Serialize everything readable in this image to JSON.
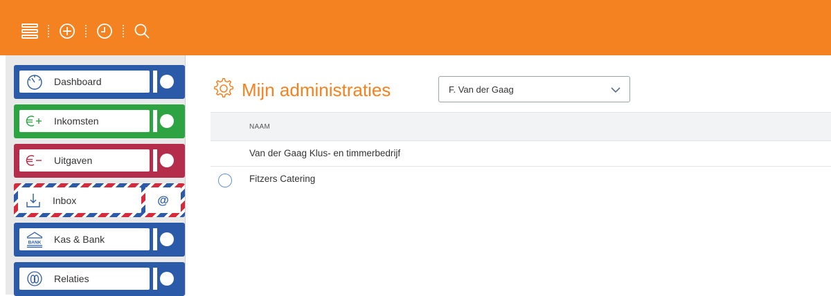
{
  "topbar": {
    "color": "#f58220",
    "icons": [
      "menu-icon",
      "add-icon",
      "clock-icon",
      "search-icon"
    ]
  },
  "sidebar": {
    "items": [
      {
        "label": "Dashboard",
        "icon": "dashboard-gauge-icon",
        "color": "#2b5ba8"
      },
      {
        "label": "Inkomsten",
        "icon": "euro-plus-icon",
        "color": "#2ea342"
      },
      {
        "label": "Uitgaven",
        "icon": "euro-minus-icon",
        "color": "#b42d4a"
      },
      {
        "label": "Inbox",
        "icon": "inbox-icon",
        "badge": "@"
      },
      {
        "label": "Kas & Bank",
        "icon": "bank-icon",
        "bank_text": "BANK",
        "color": "#2b5ba8"
      },
      {
        "label": "Relaties",
        "icon": "relations-icon",
        "color": "#2b5ba8"
      }
    ]
  },
  "main": {
    "title": "Mijn administraties",
    "title_icon": "gear-icon",
    "select_value": "F. Van der Gaag",
    "table": {
      "header": "NAAM",
      "rows": [
        {
          "name": "Van der Gaag Klus- en timmerbedrijf",
          "selected": true
        },
        {
          "name": "Fitzers Catering",
          "selected": false
        }
      ]
    }
  }
}
